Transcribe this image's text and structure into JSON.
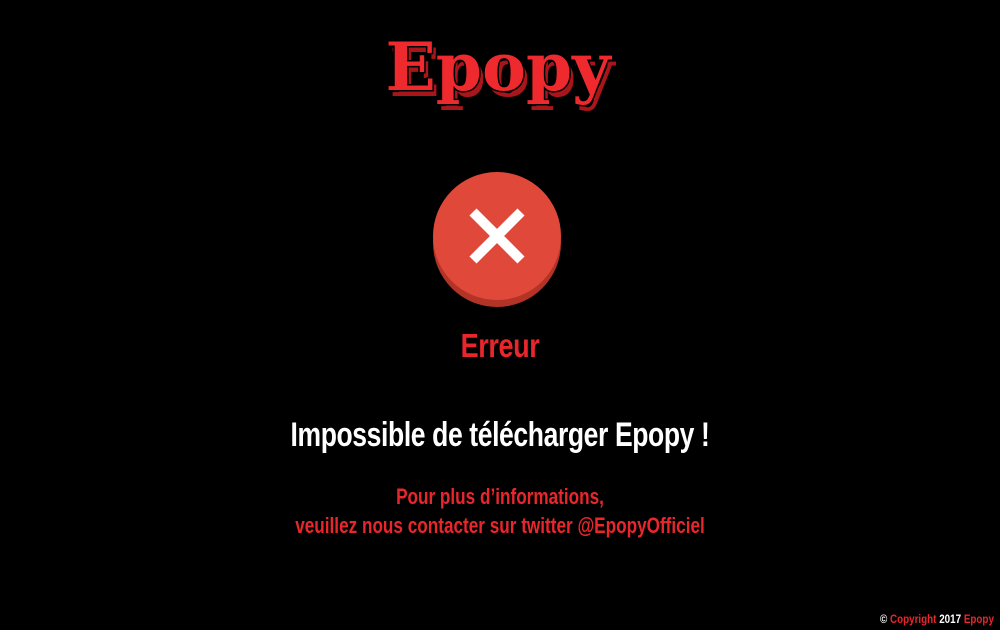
{
  "colors": {
    "background": "#000000",
    "accent_red": "#e8262c",
    "error_circle": "#e0483a",
    "error_circle_shadow": "#b33427",
    "white": "#ffffff"
  },
  "logo": {
    "text": "Epopy"
  },
  "error": {
    "icon": "close-icon",
    "title": "Erreur",
    "message": "Impossible de télécharger Epopy !"
  },
  "info": {
    "line1": "Pour plus d’informations,",
    "line2": "veuillez nous contacter sur twitter @EpopyOfficiel"
  },
  "footer": {
    "copyright_symbol": "©",
    "copyright_word": "Copyright",
    "year": "2017",
    "brand": "Epopy"
  }
}
